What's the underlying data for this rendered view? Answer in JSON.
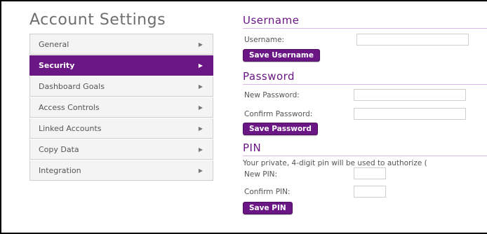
{
  "page_title": "Account Settings",
  "sidebar": {
    "items": [
      {
        "label": "General",
        "active": false
      },
      {
        "label": "Security",
        "active": true
      },
      {
        "label": "Dashboard Goals",
        "active": false
      },
      {
        "label": "Access Controls",
        "active": false
      },
      {
        "label": "Linked Accounts",
        "active": false
      },
      {
        "label": "Copy Data",
        "active": false
      },
      {
        "label": "Integration",
        "active": false
      }
    ],
    "arrow_glyph": "▶"
  },
  "username_section": {
    "title": "Username",
    "username_label": "Username:",
    "username_value": "",
    "save_label": "Save Username"
  },
  "password_section": {
    "title": "Password",
    "new_label": "New Password:",
    "confirm_label": "Confirm Password:",
    "new_value": "",
    "confirm_value": "",
    "save_label": "Save Password"
  },
  "pin_section": {
    "title": "PIN",
    "description": "Your private, 4-digit pin will be used to authorize (",
    "new_label": "New PIN:",
    "confirm_label": "Confirm PIN:",
    "new_value": "",
    "confirm_value": "",
    "save_label": "Save PIN"
  },
  "colors": {
    "accent": "#6b1685",
    "accent_border": "#4d0f61",
    "sidebar_bg": "#f4f4f4"
  },
  "icons": {
    "sidebar_arrow": "chevron-right-icon"
  }
}
